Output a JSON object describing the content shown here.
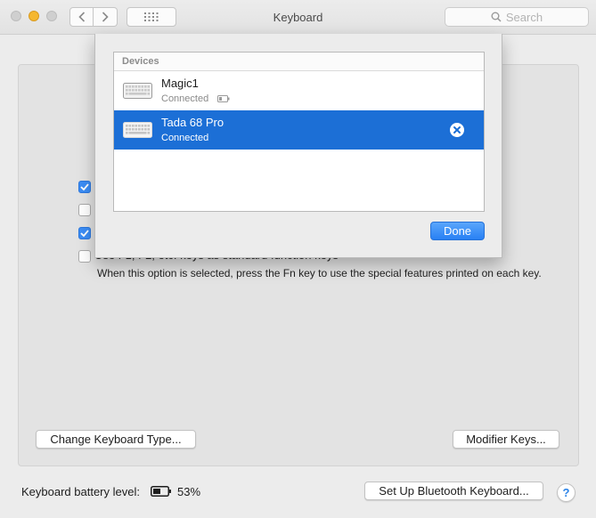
{
  "window": {
    "title": "Keyboard",
    "search_placeholder": "Search"
  },
  "sheet": {
    "devices_header": "Devices",
    "devices": [
      {
        "name": "Magic1",
        "status": "Connected",
        "selected": false
      },
      {
        "name": "Tada 68 Pro",
        "status": "Connected",
        "selected": true
      }
    ],
    "done_label": "Done"
  },
  "options": {
    "checkboxes": [
      {
        "checked": true
      },
      {
        "checked": false
      },
      {
        "checked": true
      },
      {
        "checked": false
      }
    ],
    "fn_keys_label": "Use F1, F2, etc. keys as standard function keys",
    "fn_keys_description": "When this option is selected, press the Fn key to use the special features printed on each key."
  },
  "buttons": {
    "change_keyboard_type": "Change Keyboard Type...",
    "modifier_keys": "Modifier Keys...",
    "setup_bluetooth": "Set Up Bluetooth Keyboard...",
    "help": "?"
  },
  "battery": {
    "label": "Keyboard battery level:",
    "percent_text": "53%"
  },
  "colors": {
    "accent": "#1c6fd6",
    "checkbox_checked": "#3b8df5"
  },
  "icons": {
    "search": "magnifier",
    "keyboard": "keyboard",
    "remove": "circle-x",
    "battery": "battery"
  }
}
